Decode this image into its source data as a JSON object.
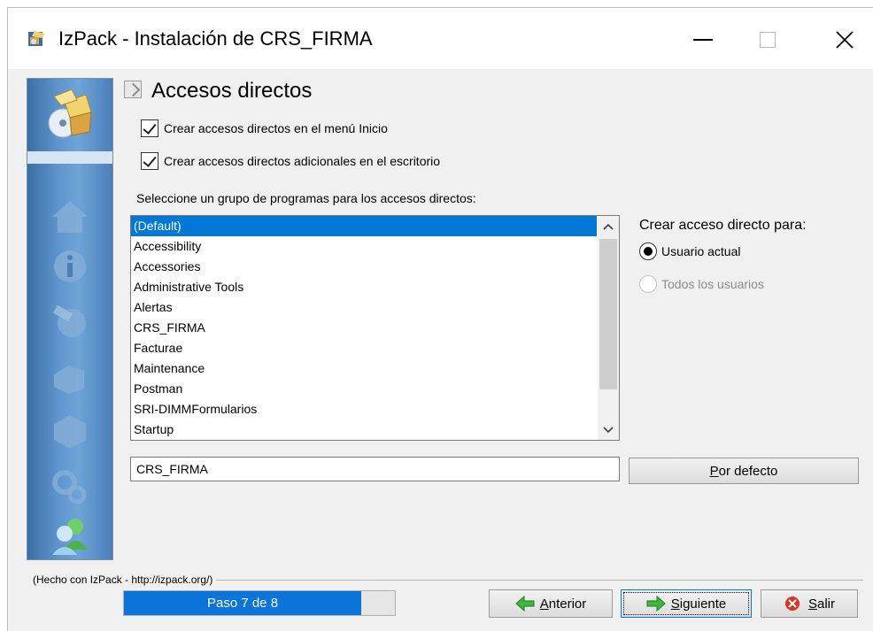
{
  "window": {
    "title": "IzPack - Instalación de  CRS_FIRMA",
    "app_icon": "izpack-installer-icon"
  },
  "sidebar": {
    "icons": [
      "installer-logo-icon",
      "home-icon",
      "info-icon",
      "license-icon",
      "packs-icon",
      "install-icon",
      "settings-icon",
      "users-icon"
    ]
  },
  "panel": {
    "title": "Accesos directos",
    "checkboxes": [
      {
        "label": "Crear accesos directos en el menú Inicio",
        "checked": true
      },
      {
        "label": "Crear accesos directos adicionales en el escritorio",
        "checked": true
      }
    ],
    "group_label": "Seleccione un grupo de programas para los accesos directos:",
    "program_groups": [
      "(Default)",
      "Accessibility",
      "Accessories",
      "Administrative Tools",
      "Alertas",
      "CRS_FIRMA",
      "Facturae",
      "Maintenance",
      "Postman",
      "SRI-DIMMFormularios",
      "Startup"
    ],
    "selected_group": "(Default)",
    "shortcut_for_label": "Crear acceso directo para:",
    "radios": [
      {
        "label": "Usuario actual",
        "checked": true,
        "enabled": true
      },
      {
        "label": "Todos los usuarios",
        "checked": false,
        "enabled": false
      }
    ],
    "group_input_value": "CRS_FIRMA",
    "default_button": {
      "mnemonic": "P",
      "rest": "or defecto"
    }
  },
  "footer": {
    "credit": "(Hecho con IzPack - http://izpack.org/)",
    "progress_text": "Paso 7 de 8",
    "progress_fraction": 0.875,
    "prev_button": {
      "mnemonic": "A",
      "rest": "nterior"
    },
    "next_button": {
      "mnemonic": "S",
      "rest": "iguiente"
    },
    "exit_button": {
      "mnemonic": "S",
      "rest": "alir"
    }
  },
  "colors": {
    "selection": "#0078d7",
    "progress": "#0a74da"
  }
}
